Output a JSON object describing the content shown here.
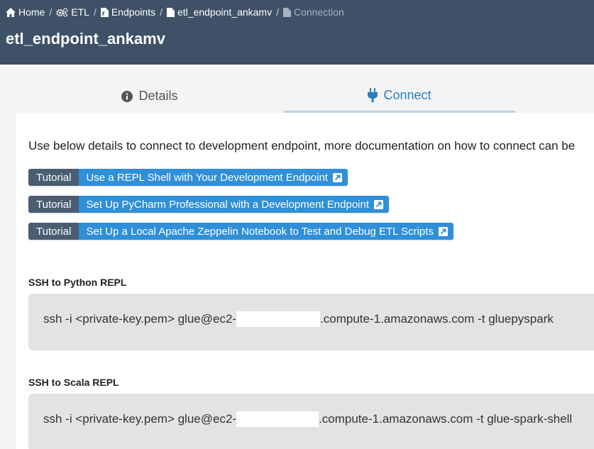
{
  "breadcrumb": {
    "home": "Home",
    "etl": "ETL",
    "endpoints": "Endpoints",
    "endpoint": "etl_endpoint_ankamv",
    "current": "Connection",
    "separator": "/"
  },
  "page_title": "etl_endpoint_ankamv",
  "tabs": {
    "details": "Details",
    "connect": "Connect"
  },
  "intro": "Use below details to connect to development endpoint, more documentation on how to connect can be",
  "tutorials": [
    {
      "tag": "Tutorial",
      "label": "Use a REPL Shell with Your Development Endpoint"
    },
    {
      "tag": "Tutorial",
      "label": "Set Up PyCharm Professional with a Development Endpoint"
    },
    {
      "tag": "Tutorial",
      "label": "Set Up a Local Apache Zeppelin Notebook to Test and Debug ETL Scripts"
    }
  ],
  "ssh_python": {
    "title": "SSH to Python REPL",
    "cmd_prefix": "ssh -i <private-key.pem> glue@ec2-",
    "cmd_suffix": ".compute-1.amazonaws.com -t gluepyspark"
  },
  "ssh_scala": {
    "title": "SSH to Scala REPL",
    "cmd_prefix": "ssh -i <private-key.pem> glue@ec2-",
    "cmd_suffix": ".compute-1.amazonaws.com -t glue-spark-shell"
  },
  "colors": {
    "header_bg": "#3e5166",
    "accent": "#2a7ec0",
    "tutorial_tag": "#4a5d71",
    "tutorial_link": "#2f8fd8",
    "code_bg": "#e3e3e3"
  },
  "icons": {
    "home": "home-icon",
    "etl": "gears-icon",
    "endpoints": "script-file-icon",
    "endpoint": "file-icon",
    "connection": "file-icon",
    "details": "info-circle-icon",
    "connect": "plug-icon",
    "external": "external-link-icon"
  }
}
